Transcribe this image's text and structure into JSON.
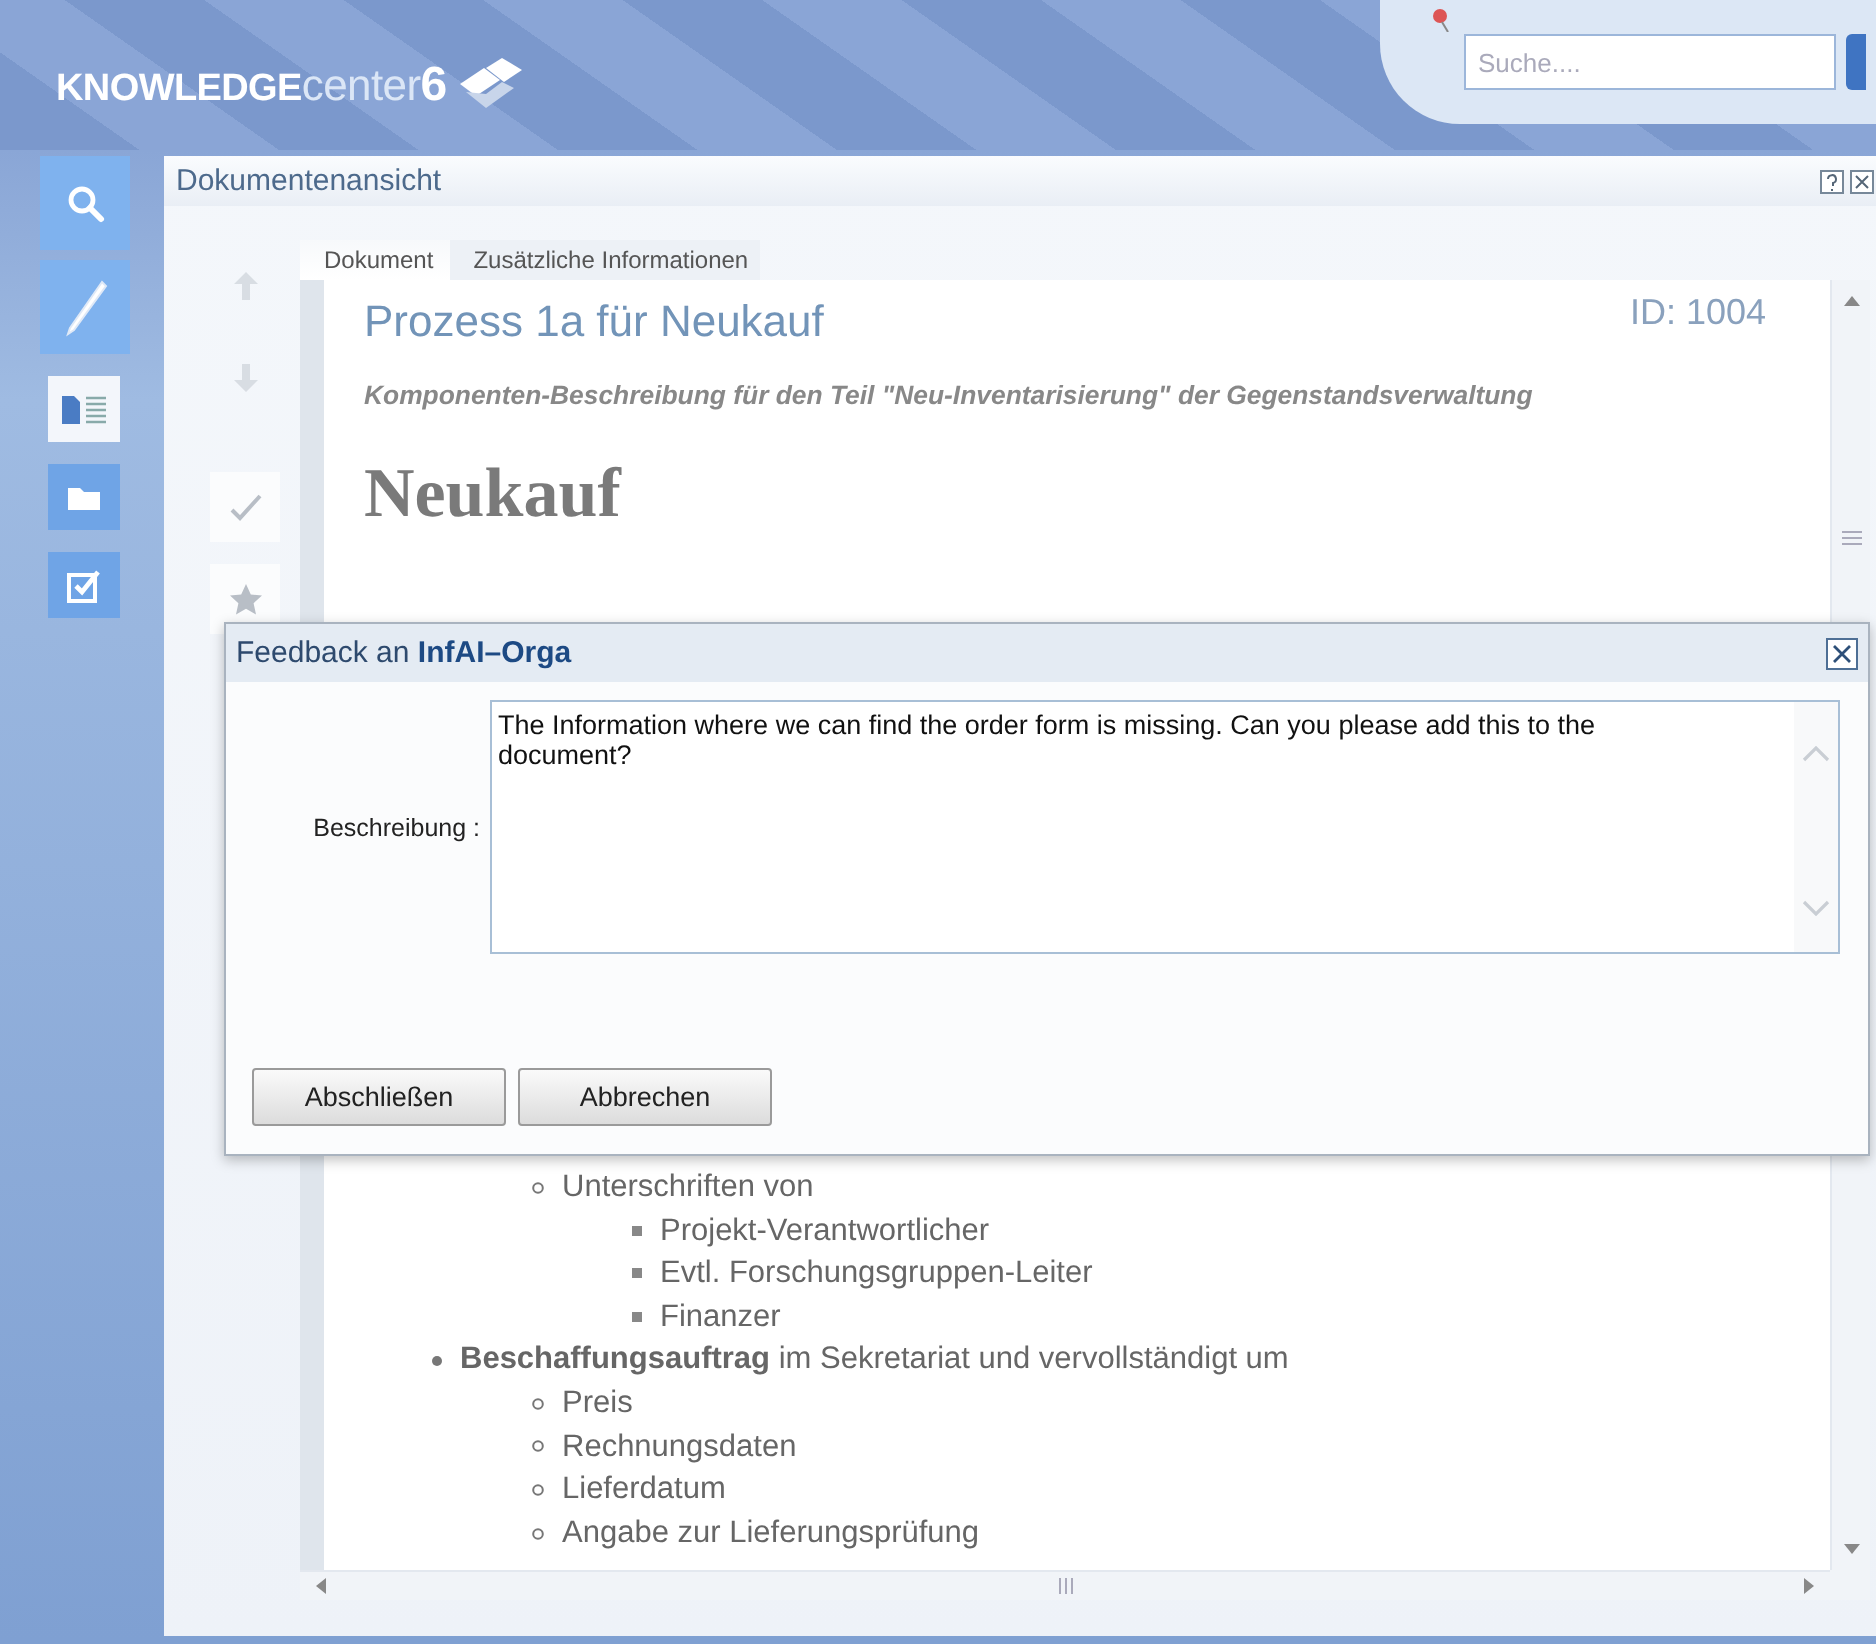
{
  "header": {
    "logo": {
      "bold": "KNOWLEDGE",
      "light": "center",
      "number": "6"
    },
    "search": {
      "placeholder": "Suche...."
    }
  },
  "sidebar": {
    "items": [
      {
        "kind": "search"
      },
      {
        "kind": "edit"
      },
      {
        "kind": "document"
      },
      {
        "kind": "folder"
      },
      {
        "kind": "task"
      }
    ]
  },
  "panel": {
    "title": "Dokumentenansicht",
    "tabs": [
      {
        "label": "Dokument",
        "selected": true
      },
      {
        "label": "Zusätzliche Informationen",
        "selected": false
      }
    ],
    "document": {
      "title": "Prozess 1a für Neukauf",
      "id": "ID: 1004",
      "subtitle": "Komponenten-Beschreibung für den Teil \"Neu-Inventarisierung\" der Gegenstandsverwaltung",
      "heading": "Neukauf",
      "list": [
        {
          "children": [
            {
              "text": "Unterschriften von",
              "children": [
                {
                  "text": "Projekt-Verantwortlicher"
                },
                {
                  "text": "Evtl. Forschungsgruppen-Leiter"
                },
                {
                  "text": "Finanzer"
                }
              ]
            }
          ]
        },
        {
          "text": "**Beschaffungsauftrag** im Sekretariat und vervollständigt um",
          "children": [
            {
              "text": "Preis"
            },
            {
              "text": "Rechnungsdaten"
            },
            {
              "text": "Lieferdatum"
            },
            {
              "text": "Angabe zur Lieferungsprüfung"
            }
          ]
        }
      ]
    }
  },
  "dialog": {
    "title": "Feedback an **InfAI–Orga**",
    "label": "Beschreibung :",
    "value": "The Information where we can find the order form is missing. Can you please add this to the document?",
    "buttons": [
      "Abschließen",
      "Abbrechen"
    ]
  }
}
